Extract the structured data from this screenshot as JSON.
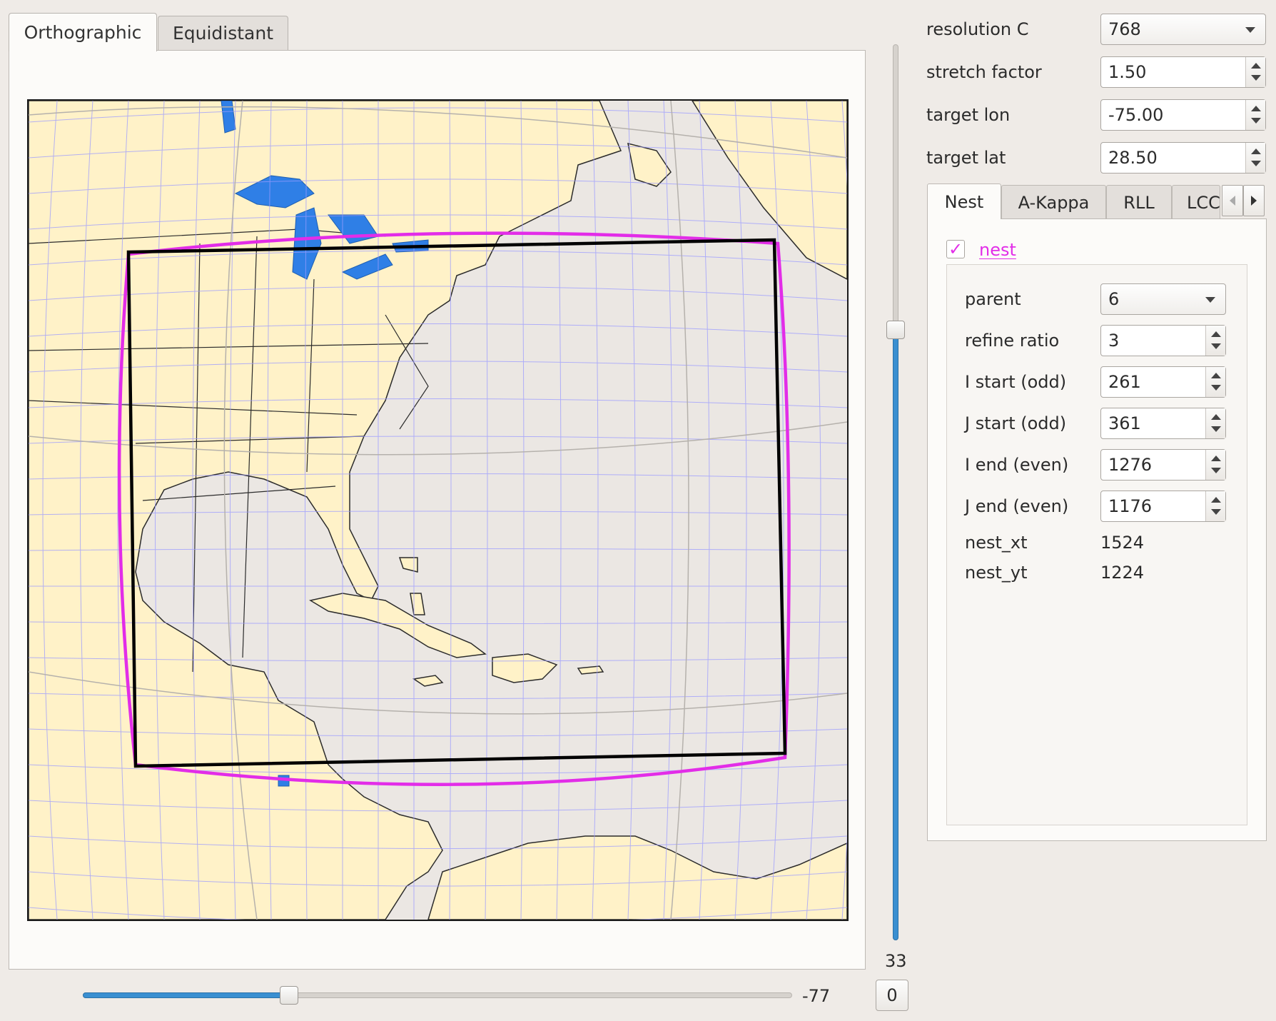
{
  "view_tabs": [
    {
      "label": "Orthographic",
      "active": true
    },
    {
      "label": "Equidistant",
      "active": false
    }
  ],
  "vertical_slider": {
    "value": "33",
    "level_fraction": 0.68
  },
  "horizontal_slider": {
    "value": "-77",
    "level_fraction": 0.29
  },
  "reset_button": {
    "label": "0"
  },
  "form": {
    "resolution": {
      "label": "resolution C",
      "value": "768"
    },
    "stretch": {
      "label": "stretch factor",
      "value": "1.50"
    },
    "target_lon": {
      "label": "target lon",
      "value": "-75.00"
    },
    "target_lat": {
      "label": "target lat",
      "value": "28.50"
    }
  },
  "config_tabs": [
    {
      "label": "Nest",
      "active": true
    },
    {
      "label": "A-Kappa",
      "active": false
    },
    {
      "label": "RLL",
      "active": false
    },
    {
      "label": "LCC",
      "active": false
    }
  ],
  "nest": {
    "checkbox_label": "nest",
    "checked": true,
    "parent": {
      "label": "parent",
      "value": "6"
    },
    "refine_ratio": {
      "label": "refine ratio",
      "value": "3"
    },
    "i_start": {
      "label": "I start (odd)",
      "value": "261"
    },
    "j_start": {
      "label": "J start (odd)",
      "value": "361"
    },
    "i_end": {
      "label": "I end (even)",
      "value": "1276"
    },
    "j_end": {
      "label": "J end (even)",
      "value": "1176"
    },
    "nest_xt": {
      "label": "nest_xt",
      "value": "1524"
    },
    "nest_yt": {
      "label": "nest_yt",
      "value": "1224"
    }
  },
  "colors": {
    "land": "#fff2c8",
    "ocean": "#ebe7e3",
    "lakes": "#2f7fe6",
    "grid": "#9b9bff",
    "nest_outline": "#000000",
    "parent_outline": "#e22de8",
    "slider_fill": "#3a8fd1",
    "accent": "#e22de8"
  }
}
